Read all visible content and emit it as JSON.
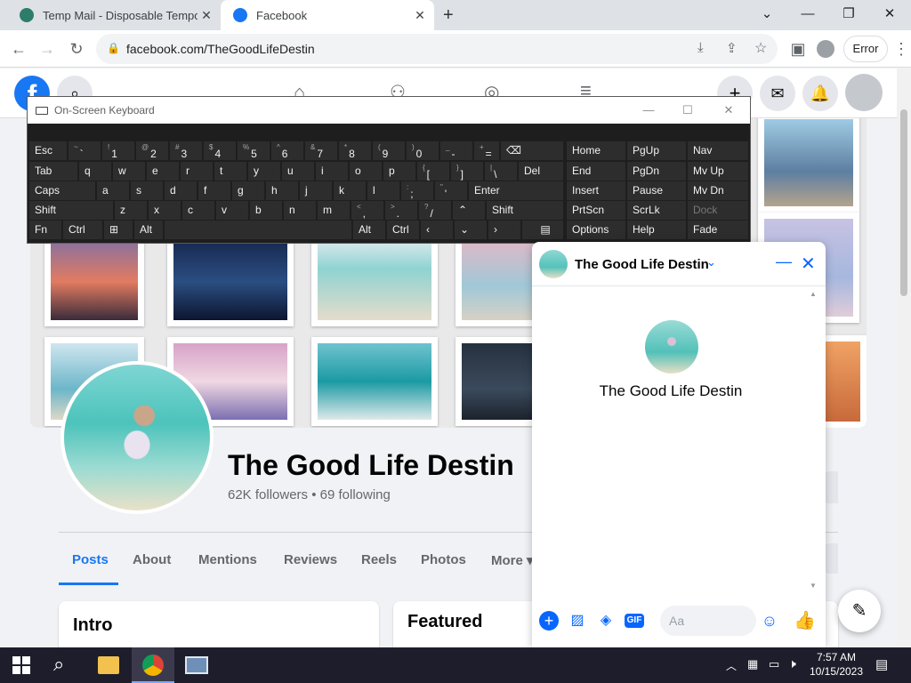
{
  "browser": {
    "tabs": [
      {
        "title": "Temp Mail - Disposable Temporary Email",
        "active": false
      },
      {
        "title": "Facebook",
        "active": true
      }
    ],
    "address": "facebook.com/TheGoodLifeDestin",
    "error_label": "Error"
  },
  "page": {
    "name": "The Good Life Destin",
    "followers": "62K followers • 69 following",
    "tabs": [
      "Posts",
      "About",
      "Mentions",
      "Reviews",
      "Reels",
      "Photos",
      "More ▾"
    ],
    "intro_title": "Intro",
    "featured_title": "Featured"
  },
  "osk": {
    "title": "On-Screen Keyboard",
    "keys": {
      "esc": "Esc",
      "tab": "Tab",
      "caps": "Caps",
      "shift": "Shift",
      "fn": "Fn",
      "ctrl": "Ctrl",
      "alt": "Alt",
      "enter": "Enter",
      "del": "Del",
      "home": "Home",
      "pgup": "PgUp",
      "nav": "Nav",
      "end": "End",
      "pgdn": "PgDn",
      "mvup": "Mv Up",
      "insert": "Insert",
      "pause": "Pause",
      "mvdn": "Mv Dn",
      "prtscn": "PrtScn",
      "scrlk": "ScrLk",
      "dock": "Dock",
      "options": "Options",
      "help": "Help",
      "fade": "Fade"
    }
  },
  "chat": {
    "name": "The Good Life Destin",
    "input_placeholder": "Aa"
  },
  "taskbar": {
    "time": "7:57 AM",
    "date": "10/15/2023"
  },
  "colors": {
    "fb_blue": "#1877f2",
    "messenger_blue": "#0866ff",
    "osk_bg": "#1e1e1e"
  }
}
